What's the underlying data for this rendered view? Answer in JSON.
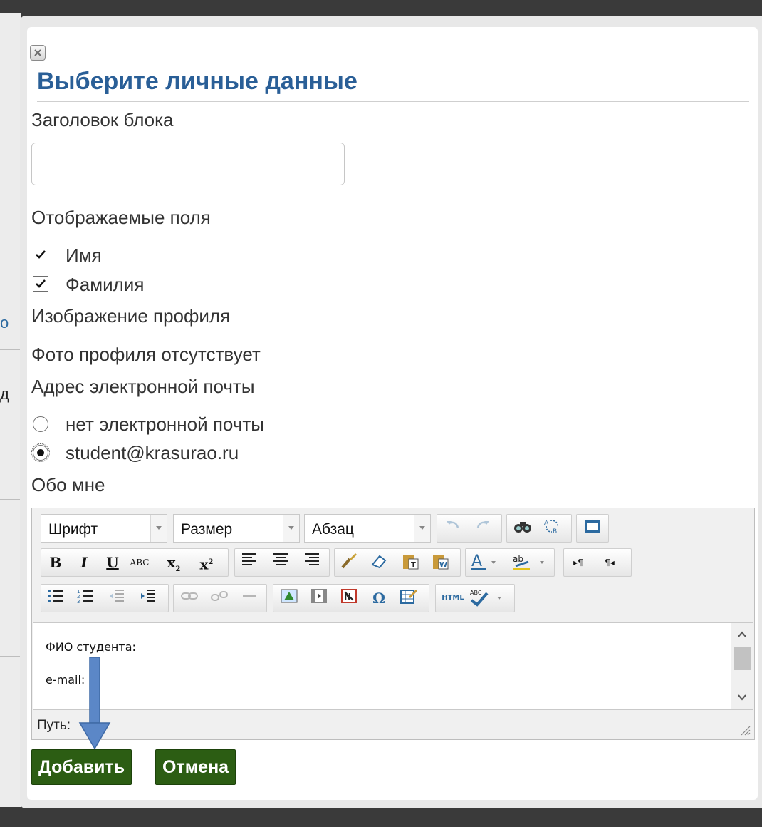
{
  "dialog": {
    "title": "Выберите личные данные",
    "block_title_label": "Заголовок блока",
    "block_title_value": "",
    "fields_label": "Отображаемые поля",
    "fields": [
      {
        "label": "Имя",
        "checked": true
      },
      {
        "label": "Фамилия",
        "checked": true
      }
    ],
    "profile_image_label": "Изображение профиля",
    "profile_image_status": "Фото профиля отсутствует",
    "email_label": "Адрес электронной почты",
    "email_options": [
      {
        "label": "нет электронной почты",
        "selected": false
      },
      {
        "label": "student@krasurao.ru",
        "selected": true
      }
    ],
    "about_label": "Обо мне"
  },
  "editor": {
    "font_combo": "Шрифт",
    "size_combo": "Размер",
    "format_combo": "Абзац",
    "content_lines": [
      "ФИО студента:",
      "e-mail:"
    ],
    "path_label": "Путь:",
    "toolbar_icons": [
      "undo-icon",
      "redo-icon",
      "find-icon",
      "replace-icon",
      "fullscreen-icon",
      "bold-icon",
      "italic-icon",
      "underline-icon",
      "strikethrough-icon",
      "subscript-icon",
      "superscript-icon",
      "align-left-icon",
      "align-center-icon",
      "align-right-icon",
      "cleanup-icon",
      "eraser-icon",
      "paste-text-icon",
      "paste-word-icon",
      "text-color-icon",
      "highlight-color-icon",
      "ltr-icon",
      "rtl-icon",
      "bullet-list-icon",
      "numbered-list-icon",
      "outdent-icon",
      "indent-icon",
      "link-icon",
      "unlink-icon",
      "image-icon",
      "media-icon",
      "anchor-icon",
      "special-char-icon",
      "edit-table-icon",
      "html-source-icon",
      "spellcheck-icon"
    ]
  },
  "buttons": {
    "add": "Добавить",
    "cancel": "Отмена"
  },
  "background": {
    "chars": [
      "о",
      "д"
    ]
  },
  "colors": {
    "title": "#2a5f97",
    "button_green": "#2c5d13",
    "annotation_arrow": "#5b87c7"
  }
}
